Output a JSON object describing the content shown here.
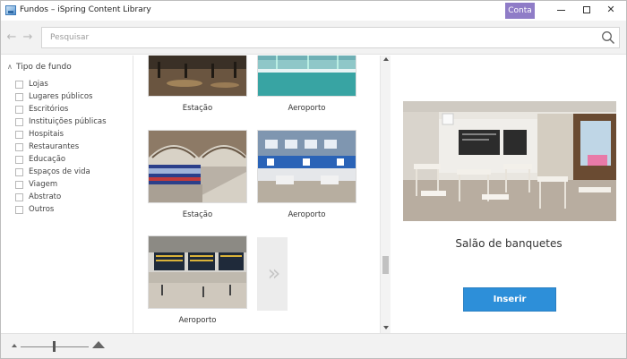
{
  "window": {
    "title": "Fundos – iSpring Content Library",
    "account_label": "Conta"
  },
  "toolbar": {
    "back_icon": "←",
    "forward_icon": "→",
    "search_placeholder": "Pesquisar"
  },
  "filters": {
    "header": "Tipo de fundo",
    "items": [
      {
        "label": "Lojas",
        "checked": false
      },
      {
        "label": "Lugares públicos",
        "checked": false
      },
      {
        "label": "Escritórios",
        "checked": false
      },
      {
        "label": "Instituições públicas",
        "checked": false
      },
      {
        "label": "Hospitais",
        "checked": false
      },
      {
        "label": "Restaurantes",
        "checked": false
      },
      {
        "label": "Educação",
        "checked": false
      },
      {
        "label": "Espaços de vida",
        "checked": false
      },
      {
        "label": "Viagem",
        "checked": false
      },
      {
        "label": "Abstrato",
        "checked": false
      },
      {
        "label": "Outros",
        "checked": false
      }
    ]
  },
  "grid": {
    "items": [
      {
        "caption": "Estação"
      },
      {
        "caption": "Aeroporto"
      },
      {
        "caption": "Estação"
      },
      {
        "caption": "Aeroporto"
      },
      {
        "caption": "Aeroporto"
      }
    ],
    "more_icon": "»"
  },
  "preview": {
    "title": "Salão de banquetes",
    "insert_label": "Inserir"
  },
  "colors": {
    "account_accent": "#8f7cc7",
    "insert_button": "#2d8fd9"
  }
}
